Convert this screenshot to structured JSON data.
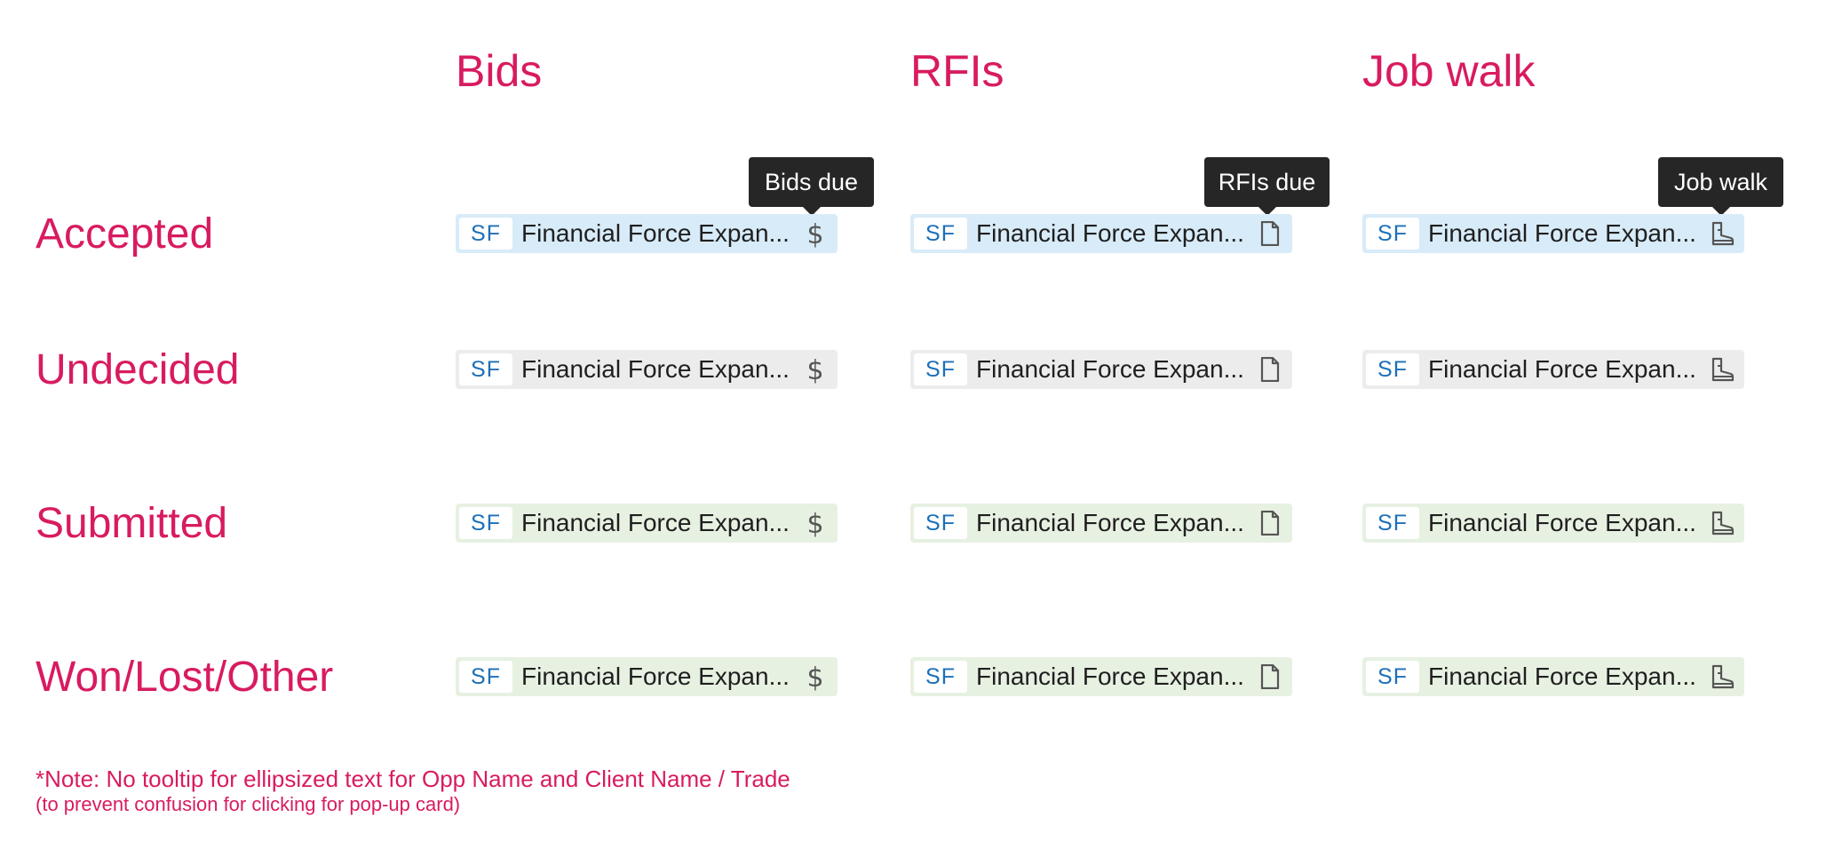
{
  "columns": {
    "bids": "Bids",
    "rfis": "RFIs",
    "job_walk": "Job walk"
  },
  "rows": {
    "accepted": "Accepted",
    "undecided": "Undecided",
    "submitted": "Submitted",
    "won": "Won/Lost/Other"
  },
  "tooltips": {
    "bids": "Bids due",
    "rfis": "RFIs due",
    "job_walk": "Job walk"
  },
  "chip": {
    "source": "SF",
    "title": "Financial Force Expan..."
  },
  "icons": {
    "bids": "dollar-icon",
    "rfis": "document-icon",
    "job_walk": "boot-icon"
  },
  "colors": {
    "accent": "#d81b60",
    "accepted_bg": "#d8ebf8",
    "undecided_bg": "#ececec",
    "submitted_bg": "#e7f1e2",
    "won_bg": "#e7f1e2",
    "source_text": "#1d6fb8",
    "tooltip_bg": "#262626"
  },
  "note": {
    "main": "*Note: No tooltip for ellipsized text for Opp Name and Client Name / Trade",
    "sub": "(to prevent confusion for clicking for pop-up card)"
  }
}
